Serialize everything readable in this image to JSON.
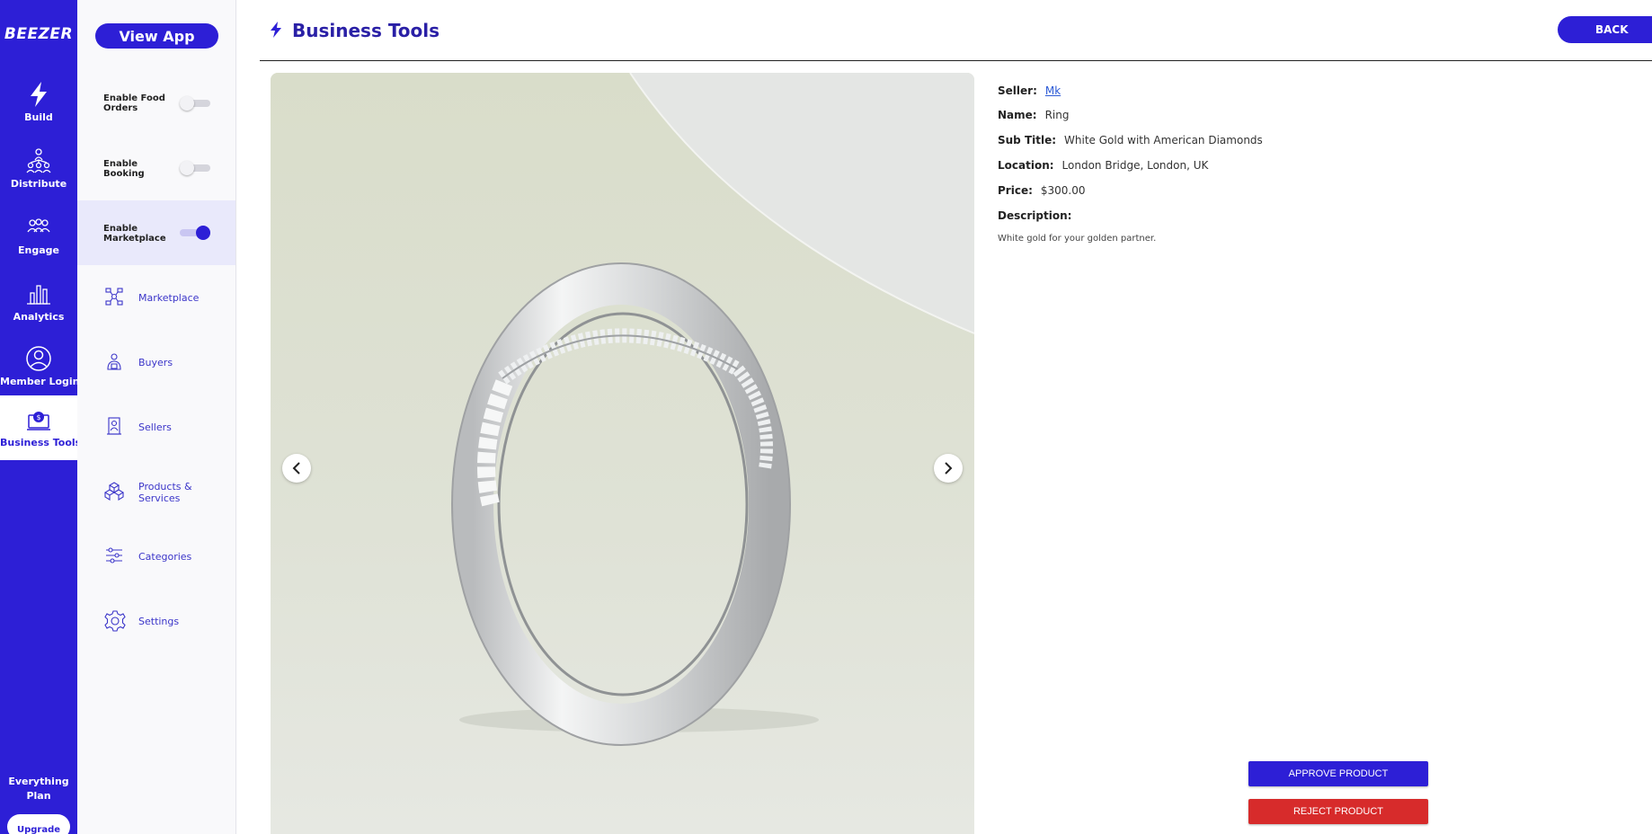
{
  "app": {
    "logo_text": "BEEZER"
  },
  "rail": {
    "items": [
      {
        "label": "Build",
        "icon": "bolt-icon"
      },
      {
        "label": "Distribute",
        "icon": "distribute-icon"
      },
      {
        "label": "Engage",
        "icon": "engage-icon"
      },
      {
        "label": "Analytics",
        "icon": "analytics-icon"
      },
      {
        "label": "Member Login",
        "icon": "member-login-icon"
      },
      {
        "label": "Business Tools",
        "icon": "business-tools-icon",
        "active": true
      }
    ],
    "plan_line1": "Everything",
    "plan_line2": "Plan",
    "upgrade_label": "Upgrade"
  },
  "sidebar": {
    "view_app_label": "View App",
    "toggles": [
      {
        "label": "Enable Food Orders",
        "on": false
      },
      {
        "label": "Enable Booking",
        "on": false
      },
      {
        "label": "Enable Marketplace",
        "on": true
      }
    ],
    "items": [
      {
        "label": "Marketplace",
        "icon": "marketplace-icon"
      },
      {
        "label": "Buyers",
        "icon": "buyers-icon"
      },
      {
        "label": "Sellers",
        "icon": "sellers-icon"
      },
      {
        "label": "Products & Services",
        "icon": "products-icon"
      },
      {
        "label": "Categories",
        "icon": "categories-icon"
      },
      {
        "label": "Settings",
        "icon": "settings-icon"
      }
    ]
  },
  "header": {
    "title": "Business Tools",
    "back_label": "BACK"
  },
  "product": {
    "seller_key": "Seller:",
    "seller": "Mk",
    "name_key": "Name:",
    "name": "Ring",
    "subtitle_key": "Sub Title:",
    "subtitle": "White Gold with American Diamonds",
    "location_key": "Location:",
    "location": "London Bridge, London, UK",
    "price_key": "Price:",
    "price": "$300.00",
    "description_key": "Description:",
    "description": "White gold for your golden partner."
  },
  "actions": {
    "approve_label": "APPROVE PRODUCT",
    "reject_label": "REJECT PRODUCT"
  },
  "colors": {
    "brand": "#2d1fd6",
    "reject": "#d72b2b",
    "header_title": "#2a20a6"
  }
}
